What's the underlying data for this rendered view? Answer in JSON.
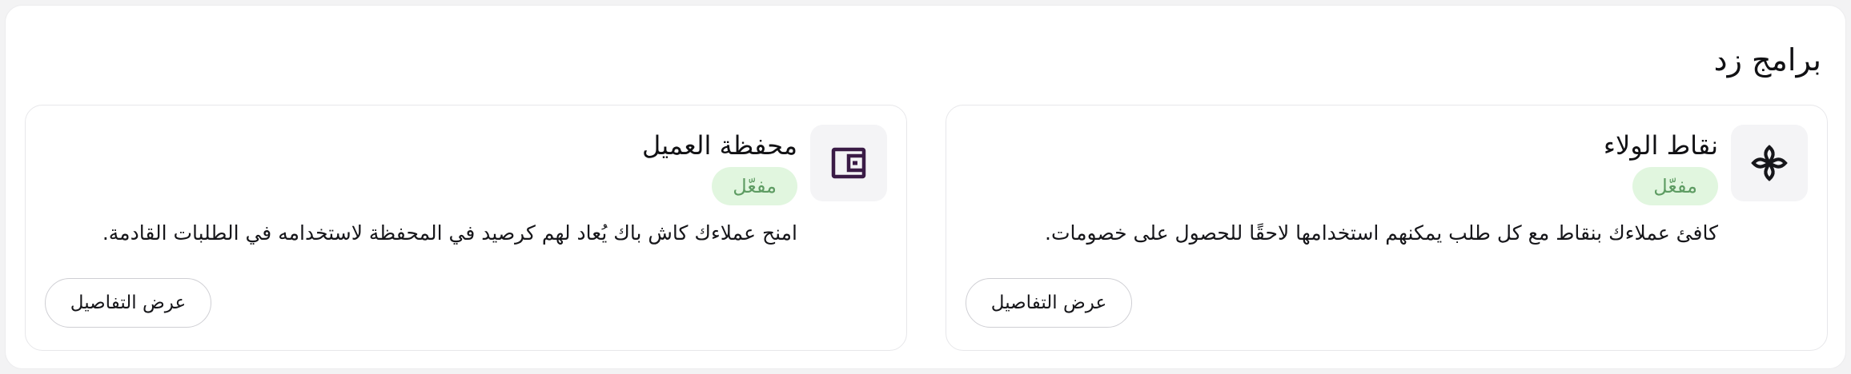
{
  "panel": {
    "title": "برامج زد"
  },
  "cards": [
    {
      "title": "نقاط الولاء",
      "status": "مفعّل",
      "description": "كافئ عملاءك بنقاط مع كل طلب يمكنهم استخدامها لاحقًا للحصول على خصومات.",
      "button_label": "عرض التفاصيل",
      "icon": "loyalty-knot-icon"
    },
    {
      "title": "محفظة العميل",
      "status": "مفعّل",
      "description": "امنح عملاءك كاش باك يُعاد لهم كرصيد في المحفظة لاستخدامه في الطلبات القادمة.",
      "button_label": "عرض التفاصيل",
      "icon": "wallet-icon"
    }
  ],
  "colors": {
    "badge_bg": "#e1f6df",
    "badge_text": "#5e9c63",
    "wallet_icon": "#3a1b46"
  }
}
